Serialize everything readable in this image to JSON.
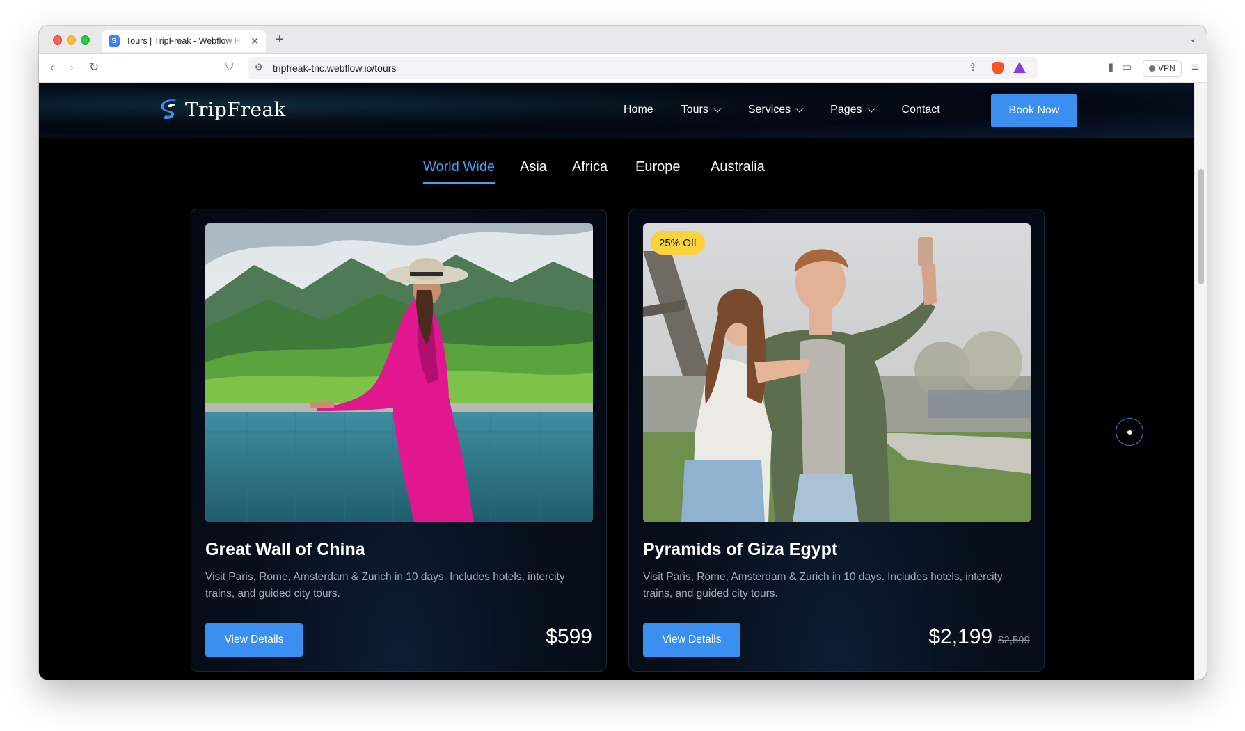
{
  "browser": {
    "tab_title": "Tours | TripFreak - Webflow H",
    "tab_favicon_letter": "S",
    "url": "tripfreak-tnc.webflow.io/tours",
    "vpn_label": "VPN"
  },
  "site": {
    "logo_text": "TripFreak",
    "nav": [
      {
        "label": "Home",
        "has_dropdown": false
      },
      {
        "label": "Tours",
        "has_dropdown": true
      },
      {
        "label": "Services",
        "has_dropdown": true
      },
      {
        "label": "Pages",
        "has_dropdown": true
      },
      {
        "label": "Contact",
        "has_dropdown": false
      }
    ],
    "cta_label": "Book Now"
  },
  "region_tabs": [
    {
      "label": "World Wide",
      "active": true
    },
    {
      "label": "Asia",
      "active": false
    },
    {
      "label": "Africa",
      "active": false
    },
    {
      "label": "Europe",
      "active": false
    },
    {
      "label": "Australia",
      "active": false
    }
  ],
  "tours": [
    {
      "title": "Great Wall of China",
      "description": "Visit Paris, Rome, Amsterdam & Zurich in 10 days. Includes hotels, intercity trains, and guided city tours.",
      "button_label": "View Details",
      "price": "$599",
      "old_price": "",
      "badge": ""
    },
    {
      "title": "Pyramids of Giza Egypt",
      "description": "Visit Paris, Rome, Amsterdam & Zurich in 10 days. Includes hotels, intercity trains, and guided city tours.",
      "button_label": "View Details",
      "price": "$2,199",
      "old_price": "$2,599",
      "badge": "25% Off"
    }
  ],
  "colors": {
    "accent": "#3b8ff0",
    "active_tab": "#4a9ff5",
    "badge": "#f9d33c",
    "page_bg": "#000000"
  }
}
